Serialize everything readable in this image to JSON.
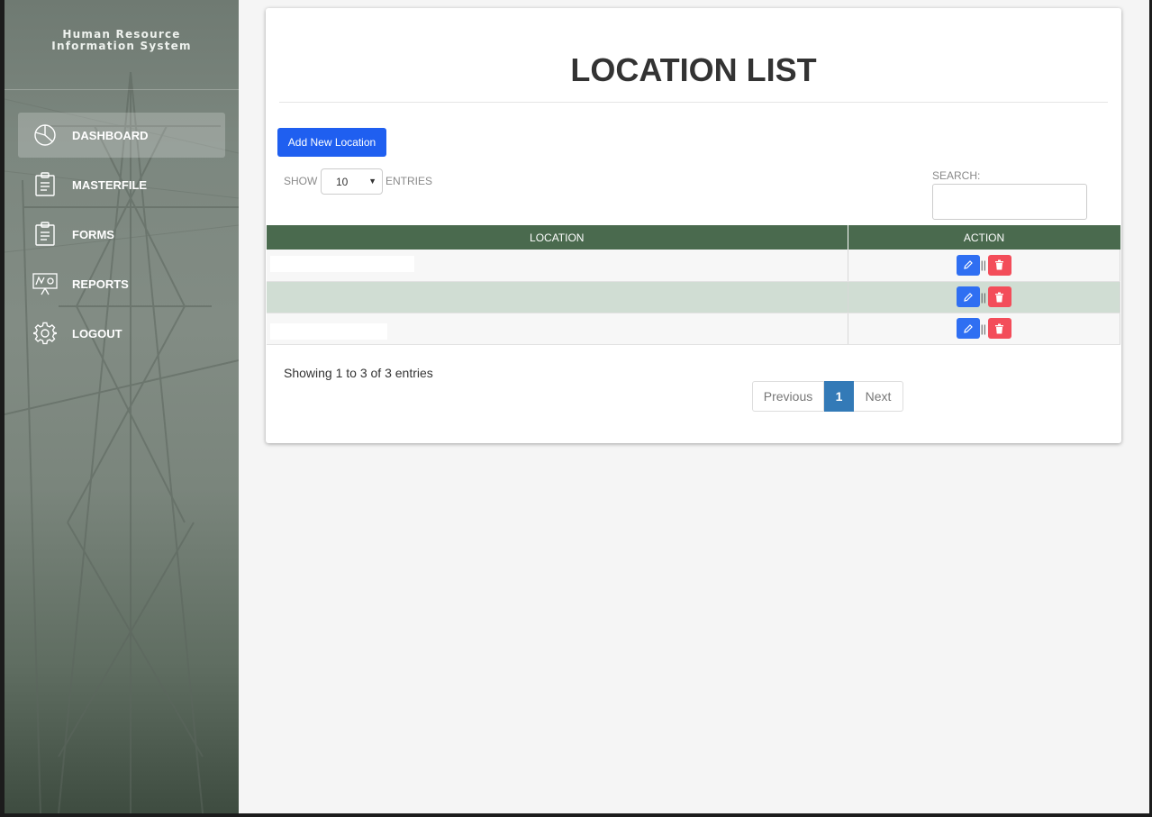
{
  "app": {
    "brand_line1": "Human Resource",
    "brand_line2": "Information System"
  },
  "sidebar": {
    "items": [
      {
        "label": "DASHBOARD",
        "icon": "pie-chart-icon",
        "active": true
      },
      {
        "label": "MASTERFILE",
        "icon": "clipboard-icon"
      },
      {
        "label": "FORMS",
        "icon": "clipboard-icon"
      },
      {
        "label": "REPORTS",
        "icon": "presentation-board-icon"
      },
      {
        "label": "LOGOUT",
        "icon": "gear-icon"
      }
    ]
  },
  "main": {
    "title": "LOCATION LIST",
    "add_button": "Add New Location",
    "show_label": "SHOW",
    "entries_value": "10",
    "entries_label": "ENTRIES",
    "search_label": "SEARCH:",
    "search_value": "",
    "table": {
      "columns": [
        "LOCATION",
        "ACTION"
      ],
      "rows": [
        {
          "location": ""
        },
        {
          "location": ""
        },
        {
          "location": ""
        }
      ]
    },
    "info": "Showing 1 to 3 of 3 entries",
    "pagination": {
      "prev": "Previous",
      "current": "1",
      "next": "Next"
    }
  },
  "colors": {
    "header_green": "#4a6a4e",
    "add_blue": "#1f5ff0",
    "edit_blue": "#2f6ff2",
    "delete_red": "#f34d5a",
    "page_active": "#337ab7"
  }
}
